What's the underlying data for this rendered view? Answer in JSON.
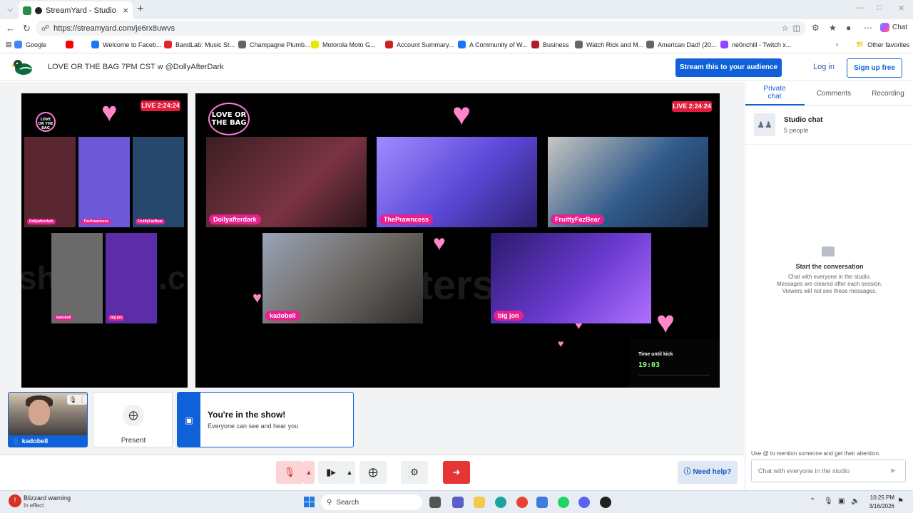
{
  "browser": {
    "tab_title": "StreamYard - Studio",
    "url": "streamyard.com/je6rx8uwvs",
    "url_full": "https://streamyard.com/je6rx8uwvs",
    "chat_label": "Chat",
    "bookmarks": [
      {
        "label": "Google",
        "color": "#4285f4"
      },
      {
        "label": "",
        "color": "#ff0000"
      },
      {
        "label": "Welcome to Faceb...",
        "color": "#1877f2"
      },
      {
        "label": "BandLab: Music St...",
        "color": "#e0262f"
      },
      {
        "label": "Champagne Plumb...",
        "color": "#666666"
      },
      {
        "label": "Motorola Moto G...",
        "color": "#e8e800"
      },
      {
        "label": "Account Summary...",
        "color": "#cc2222"
      },
      {
        "label": "A Community of W...",
        "color": "#1877f2"
      },
      {
        "label": "Business",
        "color": "#b01c2e"
      },
      {
        "label": "Watch Rick and M...",
        "color": "#666666"
      },
      {
        "label": "American Dad! (20...",
        "color": "#666666"
      },
      {
        "label": "ne0nchill - Twitch x...",
        "color": "#9146ff"
      }
    ],
    "other_favorites": "Other favorites"
  },
  "header": {
    "broadcast_title": "LOVE OR THE BAG 7PM CST w @DollyAfterDark",
    "stream_button": "Stream this to your audience",
    "login": "Log in",
    "signup": "Sign up free"
  },
  "stage": {
    "live_small": "LIVE 2:24:24",
    "live_large": "LIVE 2:24:24",
    "show_logo": "LOVE OR THE BAG",
    "participants_top": [
      {
        "name": "Dollyafterdark",
        "bg": "#5a2630"
      },
      {
        "name": "ThePrawncess",
        "bg": "#6d58d8"
      },
      {
        "name": "FruittyFazBear",
        "bg": "#26486c"
      }
    ],
    "participants_bottom": [
      {
        "name": "kadobell",
        "bg": "#6a6a6a"
      },
      {
        "name": "big jon",
        "bg": "#5b2ea8"
      }
    ],
    "watermark": "afterst",
    "watermark_small": "shuo",
    "watermark_small2": ".c",
    "timer_label": "Time until kick",
    "timer_value": "19:03"
  },
  "bottom": {
    "cam_name": "kadobell",
    "present_label": "Present",
    "inshow_title": "You're in the show!",
    "inshow_sub": "Everyone can see and hear you",
    "need_help": "Need help?"
  },
  "chat": {
    "tabs": [
      "Private chat",
      "Comments",
      "Recording"
    ],
    "room_title": "Studio chat",
    "room_sub": "5 people",
    "empty_title": "Start the conversation",
    "empty_lines": [
      "Chat with everyone in the studio.",
      "Messages are cleared after each session.",
      "Viewers will not see these messages."
    ],
    "mention_hint": "Use @ to mention someone and get their attention.",
    "input_placeholder": "Chat with everyone in the studio"
  },
  "taskbar": {
    "warning_title": "Blizzard warning",
    "warning_sub": "In effect",
    "search": "Search",
    "time": "10:25 PM",
    "date": "3/16/2026"
  }
}
